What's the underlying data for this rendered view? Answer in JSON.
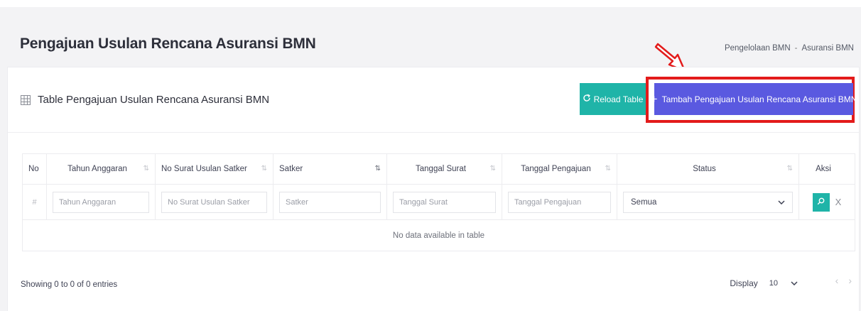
{
  "page": {
    "title": "Pengajuan Usulan Rencana Asuransi BMN"
  },
  "breadcrumb": {
    "items": [
      "Pengelolaan BMN",
      "Asuransi BMN"
    ],
    "separator": "-"
  },
  "card": {
    "title": "Table Pengajuan Usulan Rencana Asuransi BMN",
    "reload_label": "Reload Table",
    "add_label": "Tambah Pengajuan Usulan Rencana Asuransi BMN"
  },
  "table": {
    "columns": [
      "No",
      "Tahun Anggaran",
      "No Surat Usulan Satker",
      "Satker",
      "Tanggal Surat",
      "Tanggal Pengajuan",
      "Status",
      "Aksi"
    ],
    "filters": {
      "row_marker": "#",
      "tahun_placeholder": "Tahun Anggaran",
      "no_surat_placeholder": "No Surat Usulan Satker",
      "satker_placeholder": "Satker",
      "tanggal_surat_placeholder": "Tanggal Surat",
      "tanggal_pengajuan_placeholder": "Tanggal Pengajuan",
      "status_selected": "Semua",
      "clear_label": "X"
    },
    "empty_message": "No data available in table"
  },
  "footer": {
    "info": "Showing 0 to 0 of 0 entries",
    "display_label": "Display",
    "page_size": "10",
    "prev": "‹",
    "next": "›"
  },
  "colors": {
    "primary": "#5a59e0",
    "teal": "#1fb4a8",
    "highlight": "#e31b1b"
  }
}
